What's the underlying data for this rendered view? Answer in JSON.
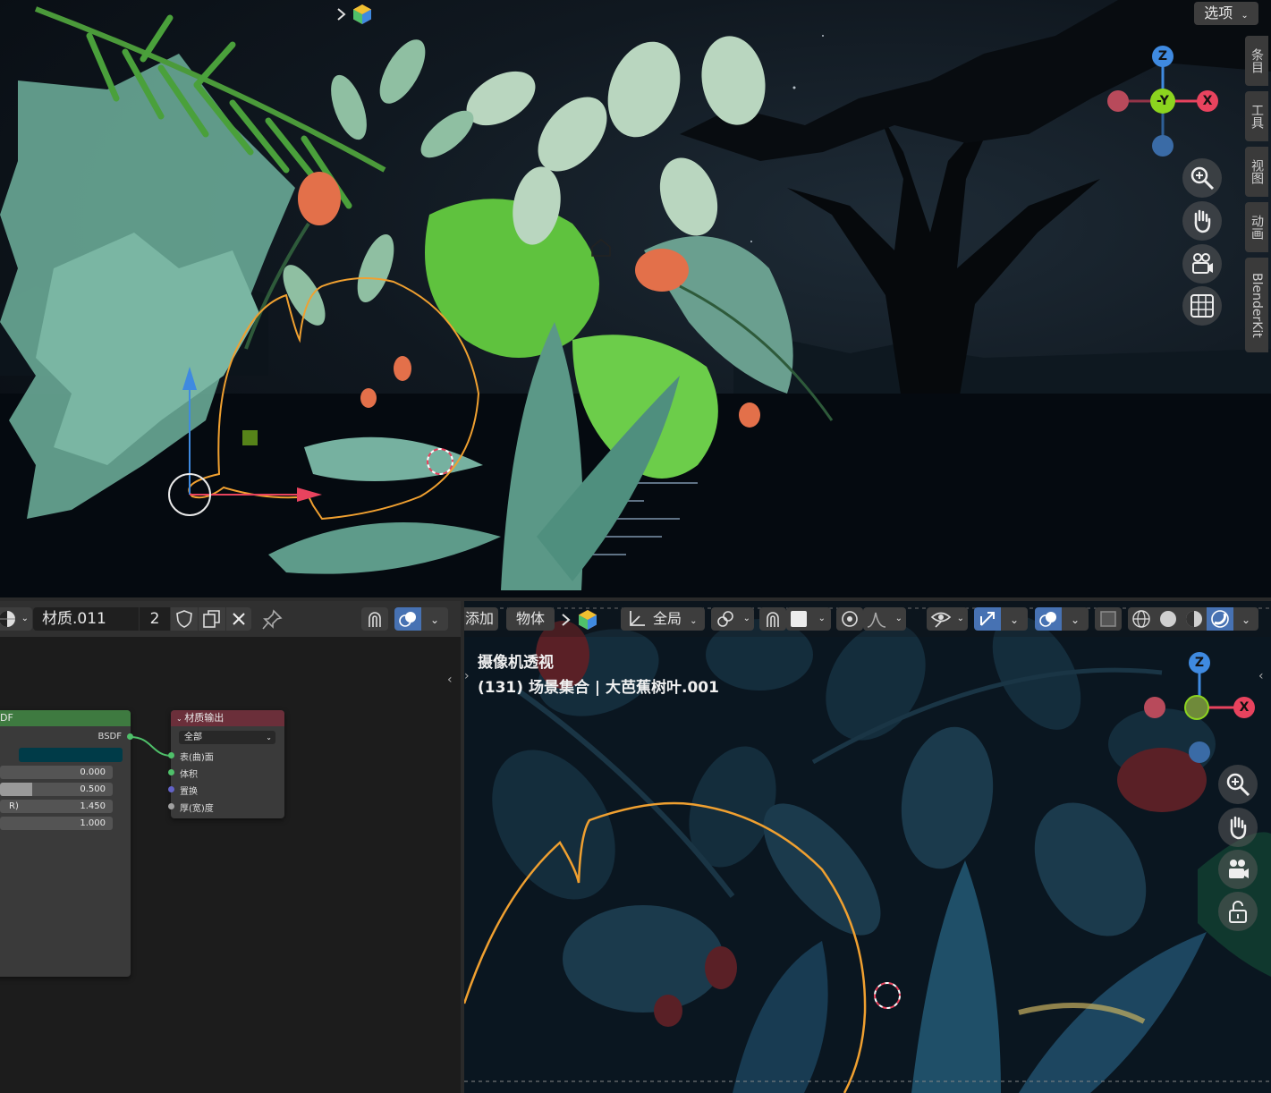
{
  "top_viewport": {
    "options_label": "选项",
    "side_tabs": [
      "条目",
      "工具",
      "视图",
      "动画",
      "BlenderKit"
    ],
    "gizmo": {
      "z": "Z",
      "y": "-Y",
      "x": "X"
    }
  },
  "node_editor": {
    "material_name": "材质.011",
    "user_count": "2",
    "bsdf_node": {
      "title": "DF",
      "output_label": "BSDF",
      "fields": [
        {
          "label": "",
          "value": "0.000",
          "fill": 0
        },
        {
          "label": "",
          "value": "0.500",
          "fill": 0.25
        },
        {
          "label": "R)",
          "value": "1.450",
          "fill": 0
        },
        {
          "label": "",
          "value": "1.000",
          "fill": 0
        }
      ]
    },
    "output_node": {
      "title": "材质输出",
      "target": "全部",
      "inputs": [
        "表(曲)面",
        "体积",
        "置换",
        "厚(宽)度"
      ]
    }
  },
  "camera_viewport": {
    "menu": [
      "添加",
      "物体"
    ],
    "transform_orientation": "全局",
    "overlay_title": "摄像机透视",
    "overlay_info": "(131) 场景集合 | 大芭蕉树叶.001",
    "gizmo": {
      "x": "X"
    }
  },
  "colors": {
    "accent": "#4772b3",
    "axis_x": "#e8435e",
    "axis_y": "#8cd41f",
    "axis_z": "#3f8ae0",
    "selection": "#f0a030",
    "output_node_header": "#6b2f3a",
    "bsdf_node_header": "#3e7a40"
  }
}
